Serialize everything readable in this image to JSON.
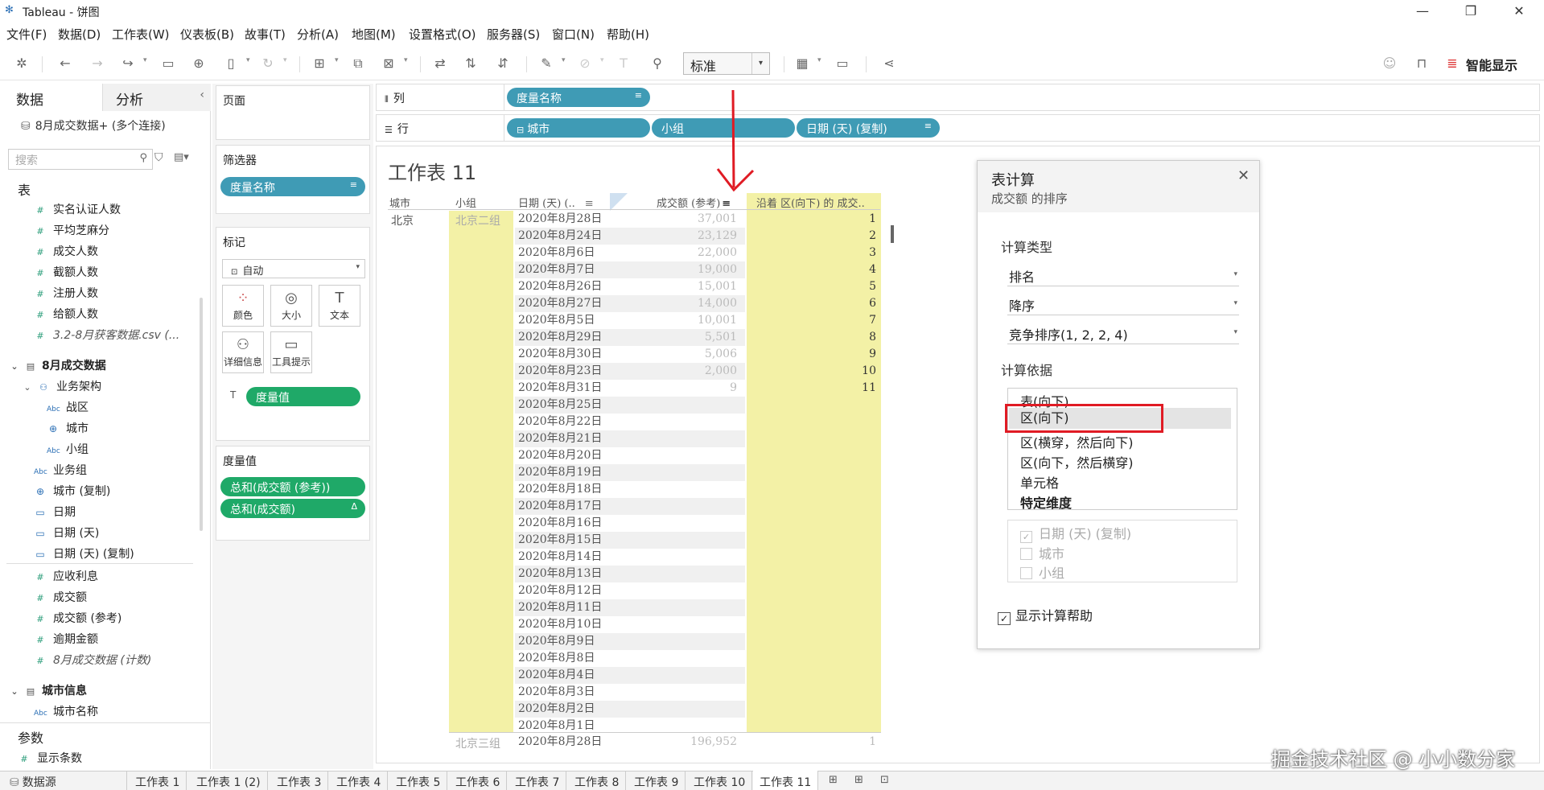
{
  "window": {
    "title": "Tableau - 饼图",
    "minimize": "—",
    "restore": "❐",
    "close": "✕"
  },
  "menu": [
    "文件(F)",
    "数据(D)",
    "工作表(W)",
    "仪表板(B)",
    "故事(T)",
    "分析(A)",
    "地图(M)",
    "设置格式(O)",
    "服务器(S)",
    "窗口(N)",
    "帮助(H)"
  ],
  "toolbar": {
    "fit": "标准",
    "show_me": "智能显示"
  },
  "left": {
    "tab_data": "数据",
    "tab_analysis": "分析",
    "connection": "8月成交数据+ (多个连接)",
    "search_placeholder": "搜索",
    "section_table": "表",
    "fields_a": [
      "实名认证人数",
      "平均芝麻分",
      "成交人数",
      "截额人数",
      "注册人数",
      "给额人数"
    ],
    "csv": "3.2-8月获客数据.csv (...",
    "section_aug": "8月成交数据",
    "hier": "业务架构",
    "hier_items": [
      "战区",
      "城市",
      "小组"
    ],
    "dims": [
      "业务组",
      "城市 (复制)",
      "日期",
      "日期 (天)",
      "日期 (天) (复制)"
    ],
    "measures": [
      "应收利息",
      "成交额",
      "成交额 (参考)",
      "逾期金额"
    ],
    "count": "8月成交数据 (计数)",
    "section_city": "城市信息",
    "city_name": "城市名称",
    "params": "参数",
    "param1": "显示条数"
  },
  "shelves": {
    "pages": "页面",
    "filters": "筛选器",
    "filter_pill": "度量名称",
    "marks": "标记",
    "mark_type": "自动",
    "mark_buttons": [
      "颜色",
      "大小",
      "文本",
      "详细信息",
      "工具提示"
    ],
    "mark_pill": "度量值",
    "measure_values": "度量值",
    "mv_pills": [
      "总和(成交额 (参考))",
      "总和(成交额)"
    ],
    "columns": "列",
    "rows": "行",
    "col_pill": "度量名称",
    "row_pills": [
      "城市",
      "小组",
      "日期 (天) (复制)"
    ]
  },
  "sheet": {
    "title": "工作表 11",
    "headers": [
      "城市",
      "小组",
      "日期 (天) (..",
      "成交额 (参考)",
      "沿着 区(向下) 的 成交.."
    ],
    "city": "北京",
    "group1": "北京二组",
    "group2": "北京三组",
    "dates": [
      "2020年8月28日",
      "2020年8月24日",
      "2020年8月6日",
      "2020年8月7日",
      "2020年8月26日",
      "2020年8月27日",
      "2020年8月5日",
      "2020年8月29日",
      "2020年8月30日",
      "2020年8月23日",
      "2020年8月31日",
      "2020年8月25日",
      "2020年8月22日",
      "2020年8月21日",
      "2020年8月20日",
      "2020年8月19日",
      "2020年8月18日",
      "2020年8月17日",
      "2020年8月16日",
      "2020年8月15日",
      "2020年8月14日",
      "2020年8月13日",
      "2020年8月12日",
      "2020年8月11日",
      "2020年8月10日",
      "2020年8月9日",
      "2020年8月8日",
      "2020年8月4日",
      "2020年8月3日",
      "2020年8月2日",
      "2020年8月1日"
    ],
    "values": [
      "37,001",
      "23,129",
      "22,000",
      "19,000",
      "15,001",
      "14,000",
      "10,001",
      "5,501",
      "5,006",
      "2,000",
      "9"
    ],
    "ranks": [
      "1",
      "2",
      "3",
      "4",
      "5",
      "6",
      "7",
      "8",
      "9",
      "10",
      "11"
    ],
    "g2_date": "2020年8月28日",
    "g2_value": "196,952",
    "g2_rank": "1"
  },
  "dialog": {
    "title": "表计算",
    "subtitle": "成交额 的排序",
    "calc_type_label": "计算类型",
    "calc_type": "排名",
    "order": "降序",
    "rank_mode": "竞争排序(1, 2, 2, 4)",
    "compute_label": "计算依据",
    "compute_options": [
      "表(向下)",
      "区(向下)",
      "区(横穿，然后向下)",
      "区(向下，然后横穿)",
      "单元格",
      "特定维度"
    ],
    "dims": [
      "日期 (天) (复制)",
      "城市",
      "小组"
    ],
    "show_help": "显示计算帮助"
  },
  "bottom_tabs": [
    "数据源",
    "工作表 1",
    "工作表 1 (2)",
    "工作表 3",
    "工作表 4",
    "工作表 5",
    "工作表 6",
    "工作表 7",
    "工作表 8",
    "工作表 9",
    "工作表 10",
    "工作表 11"
  ],
  "watermark": "掘金技术社区 @ 小小数分家",
  "colors": {
    "pill_blue": "#3f9bb5",
    "pill_green": "#1fa968",
    "highlight": "#f3f1a6",
    "annotation": "#e01b24"
  }
}
